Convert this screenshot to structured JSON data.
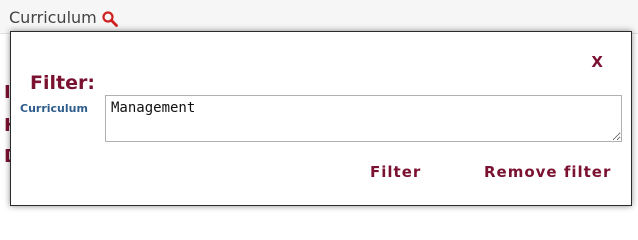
{
  "background": {
    "title": "Curriculum",
    "search_icon": "search-icon",
    "peek_letters": [
      "I",
      "H",
      "D"
    ]
  },
  "dialog": {
    "close_label": "X",
    "heading": "Filter:",
    "field": {
      "label": "Curriculum",
      "value": "Management"
    },
    "filter_label": "Filter",
    "remove_filter_label": "Remove filter"
  },
  "colors": {
    "accent": "#7b1130",
    "label_blue": "#2e5d8c",
    "search_icon_red": "#d02020"
  }
}
